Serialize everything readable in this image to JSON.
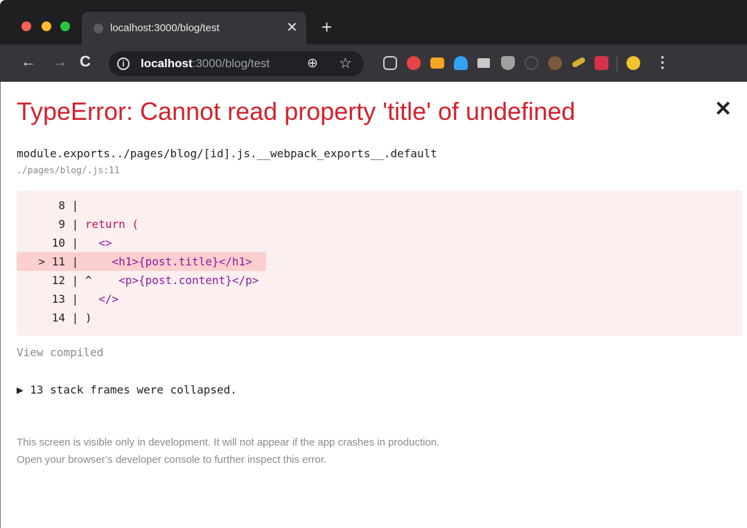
{
  "browser": {
    "tab": {
      "title": "localhost:3000/blog/test",
      "close_glyph": "✕"
    },
    "new_tab_glyph": "+",
    "nav": {
      "back_glyph": "←",
      "forward_glyph": "→",
      "reload_glyph": "C"
    },
    "omnibox": {
      "info_glyph": "i",
      "url_host": "localhost",
      "url_rest": ":3000/blog/test",
      "zoom_glyph": "⊕",
      "star_glyph": "☆"
    },
    "extensions": [
      "pocket-icon",
      "brave-shield-icon",
      "wallet-icon",
      "ghostery-icon",
      "reader-icon",
      "ublock-icon",
      "info-extension-icon",
      "cookie-icon",
      "css-peeper-icon",
      "puzzle-extension-icon",
      "profile-avatar-icon"
    ],
    "menu_glyph": "⋮"
  },
  "error": {
    "title": "TypeError: Cannot read property 'title' of undefined",
    "close_glyph": "✕",
    "frame_function": "module.exports../pages/blog/[id].js.__webpack_exports__.default",
    "frame_file": "./pages/blog/.js:11",
    "code_lines": [
      {
        "marker": "",
        "number": "8",
        "caret": "",
        "code": ""
      },
      {
        "marker": "",
        "number": "9",
        "caret": "",
        "code": "return ("
      },
      {
        "marker": "",
        "number": "10",
        "caret": "",
        "code": "  <>"
      },
      {
        "marker": ">",
        "number": "11",
        "caret": "",
        "code": "    <h1>{post.title}</h1>"
      },
      {
        "marker": "",
        "number": "12",
        "caret": "^",
        "code": "    <p>{post.content}</p>"
      },
      {
        "marker": "",
        "number": "13",
        "caret": "",
        "code": "  </>"
      },
      {
        "marker": "",
        "number": "14",
        "caret": "",
        "code": ")"
      }
    ],
    "highlighted_line": "11",
    "view_compiled": "View compiled",
    "collapsed_frames": "▶ 13 stack frames were collapsed.",
    "footer_line1": "This screen is visible only in development. It will not appear if the app crashes in production.",
    "footer_line2": "Open your browser’s developer console to further inspect this error."
  },
  "colors": {
    "error_red": "#d1222c",
    "code_bg": "#fcefef",
    "highlight_bg": "#fccfcf"
  }
}
